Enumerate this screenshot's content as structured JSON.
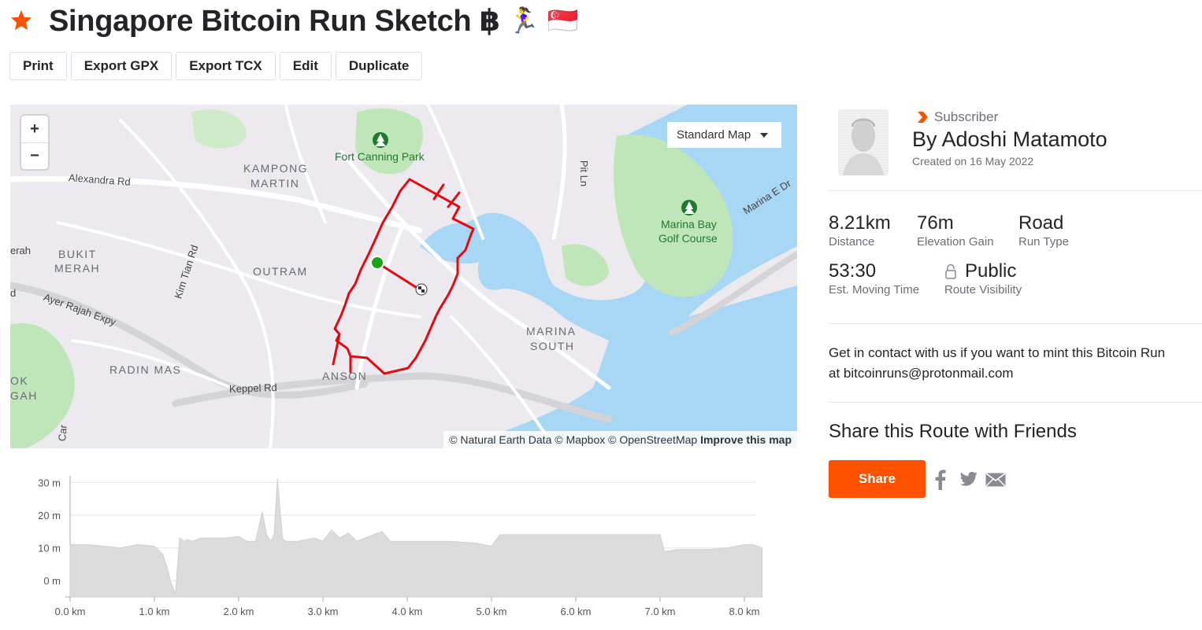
{
  "header": {
    "title": "Singapore Bitcoin Run Sketch ฿",
    "emojis": "🏃‍♀️ 🇸🇬",
    "star_icon": "star-icon",
    "accent": "#fc5200"
  },
  "toolbar": {
    "print": "Print",
    "export_gpx": "Export GPX",
    "export_tcx": "Export TCX",
    "edit": "Edit",
    "duplicate": "Duplicate"
  },
  "map": {
    "zoom_in": "+",
    "zoom_out": "−",
    "style_selector": "Standard Map",
    "attribution_prefix": "© Natural Earth Data © Mapbox © OpenStreetMap",
    "attribution_link": "Improve this map",
    "route_color": "#e8080f",
    "start_color": "#1aa31a",
    "labels": {
      "kampong": "KAMPONG",
      "martin": "MARTIN",
      "bukit": "BUKIT",
      "merah": "MERAH",
      "outram": "OUTRAM",
      "radin_mas": "RADIN MAS",
      "anson": "ANSON",
      "marina": "MARINA",
      "south": "SOUTH",
      "ok": "OK",
      "gah": "GAH",
      "erah": "erah",
      "d": "d"
    },
    "roads": {
      "alexandra": "Alexandra Rd",
      "kim_tian": "Kim Tian Rd",
      "ayer_rajah": "Ayer Rajah Expy",
      "keppel": "Keppel Rd",
      "pit_ln": "Pit Ln",
      "marina_e": "Marina E Dr",
      "car": "Car"
    },
    "parks": {
      "fort_canning": "Fort Canning Park",
      "marina_bay_golf_1": "Marina Bay",
      "marina_bay_golf_2": "Golf Course"
    }
  },
  "author": {
    "badge": "Subscriber",
    "name": "By Adoshi Matamoto",
    "created": "Created on 16 May 2022"
  },
  "stats": {
    "distance": {
      "value": "8.21km",
      "label": "Distance"
    },
    "elevation": {
      "value": "76m",
      "label": "Elevation Gain"
    },
    "type": {
      "value": "Road",
      "label": "Run Type"
    },
    "time": {
      "value": "53:30",
      "label": "Est. Moving Time"
    },
    "visibility": {
      "value": "Public",
      "label": "Route Visibility"
    }
  },
  "contact": {
    "line1": "Get in contact with us if you want to mint this Bitcoin Run",
    "line2": "at bitcoinruns@protonmail.com"
  },
  "share": {
    "title": "Share this Route with Friends",
    "button": "Share",
    "icons": [
      "facebook-icon",
      "twitter-icon",
      "email-icon"
    ]
  },
  "chart_data": {
    "type": "area",
    "xlabel": "",
    "ylabel": "",
    "x_ticks": [
      "0.0 km",
      "1.0 km",
      "2.0 km",
      "3.0 km",
      "4.0 km",
      "5.0 km",
      "6.0 km",
      "7.0 km",
      "8.0 km"
    ],
    "y_ticks": [
      "30 m",
      "20 m",
      "10 m",
      "0 m"
    ],
    "xlim": [
      0,
      8.21
    ],
    "ylim": [
      -5,
      32
    ],
    "grid": true,
    "fill_color": "#dcdcdc",
    "x": [
      0,
      0.2,
      0.4,
      0.6,
      0.8,
      1.0,
      1.1,
      1.15,
      1.2,
      1.25,
      1.3,
      1.35,
      1.4,
      1.45,
      1.55,
      1.7,
      1.85,
      2.0,
      2.1,
      2.2,
      2.28,
      2.33,
      2.38,
      2.42,
      2.46,
      2.48,
      2.52,
      2.56,
      2.6,
      2.7,
      2.9,
      3.0,
      3.1,
      3.2,
      3.3,
      3.4,
      3.5,
      3.6,
      3.7,
      3.8,
      3.9,
      4.0,
      4.2,
      4.5,
      4.8,
      5.0,
      5.1,
      5.3,
      5.6,
      5.9,
      6.2,
      6.5,
      6.8,
      7.0,
      7.05,
      7.1,
      7.2,
      7.4,
      7.6,
      7.8,
      8.0,
      8.1,
      8.21
    ],
    "y": [
      11,
      11,
      10.5,
      10,
      11,
      10.5,
      8,
      4,
      -1,
      -4,
      13,
      12,
      12.5,
      12,
      13,
      13,
      13,
      13.5,
      12,
      12,
      21,
      14,
      12,
      14,
      31,
      25,
      13,
      12,
      12,
      12,
      13,
      12,
      15.5,
      13,
      14.5,
      12,
      13,
      14,
      15,
      12,
      12,
      12,
      12,
      12,
      11.5,
      10.5,
      14,
      14,
      14,
      14,
      14,
      14,
      14,
      14,
      9,
      9,
      9.5,
      9.5,
      9.5,
      10,
      11,
      11,
      10
    ]
  }
}
